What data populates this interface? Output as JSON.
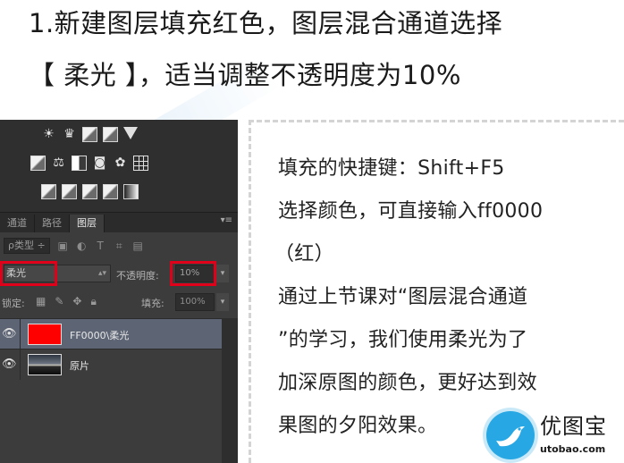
{
  "heading": {
    "line1": "1.新建图层填充红色，图层混合通道选择",
    "line2": "【 柔光 】，适当调整不透明度为10%"
  },
  "photoshop": {
    "tabs": [
      {
        "label": "通道",
        "active": false
      },
      {
        "label": "路径",
        "active": false
      },
      {
        "label": "图层",
        "active": true
      }
    ],
    "panel_menu": "▾≡",
    "filter": {
      "kind_label": "ρ类型 ÷"
    },
    "blend_mode": "柔光",
    "opacity_label": "不透明度:",
    "opacity_value": "10%",
    "lock_label": "锁定:",
    "fill_label": "填充:",
    "fill_value": "100%",
    "layers": [
      {
        "name": "FF0000\\柔光",
        "thumb": "red-fill",
        "selected": true
      },
      {
        "name": "原片",
        "thumb": "photo",
        "selected": false
      }
    ],
    "highlight_color": "#e0001a",
    "selected_color": "#5d6575"
  },
  "note": {
    "lines": [
      "填充的快捷键：Shift+F5",
      "选择颜色，可直接输入ff0000",
      "（红）",
      "通过上节课对“图层混合通道",
      "”的学习，我们使用柔光为了",
      "加深原图的颜色，更好达到效",
      "果图的夕阳效果。"
    ]
  },
  "logo": {
    "name": "优图宝",
    "url": "utobao.com",
    "color": "#27a7e4"
  }
}
